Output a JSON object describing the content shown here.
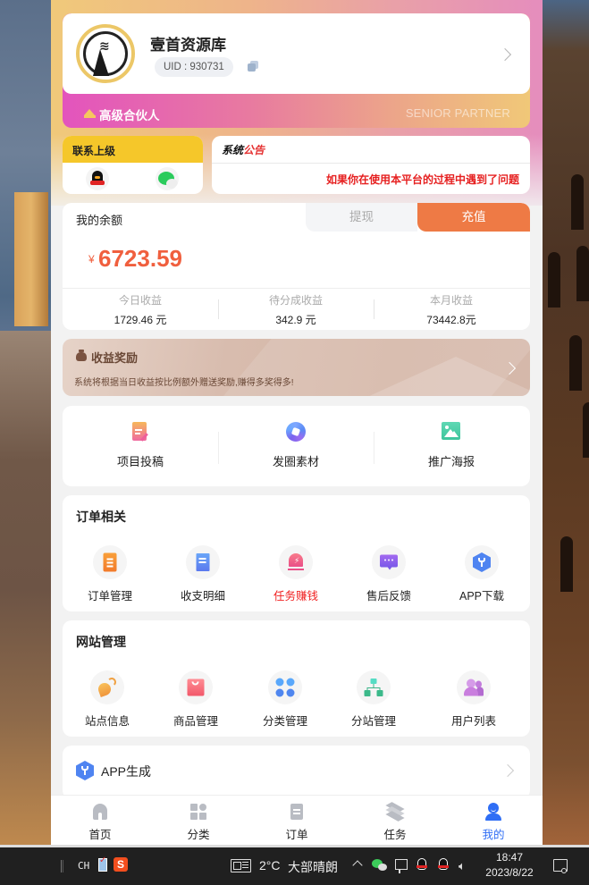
{
  "profile": {
    "name": "壹首资源库",
    "uid": "UID : 930731",
    "level": "高级合伙人",
    "level_en": "SENIOR PARTNER"
  },
  "contact": {
    "title": "联系上级",
    "icons": [
      "qq-icon",
      "wechat-icon"
    ]
  },
  "notice": {
    "title_part1": "系统",
    "title_part2": "公告",
    "message": "如果你在使用本平台的过程中遇到了问题"
  },
  "balance": {
    "title": "我的余额",
    "withdraw_label": "提现",
    "recharge_label": "充值",
    "currency": "¥",
    "amount": "6723.59",
    "stats": [
      {
        "label": "今日收益",
        "value": "1729.46 元"
      },
      {
        "label": "待分成收益",
        "value": "342.9 元"
      },
      {
        "label": "本月收益",
        "value": "73442.8元"
      }
    ]
  },
  "reward": {
    "title": "收益奖励",
    "description": "系统将根据当日收益按比例额外赠送奖励,赚得多奖得多!"
  },
  "quick_actions": [
    {
      "label": "项目投稿",
      "icon": "document-edit-icon"
    },
    {
      "label": "发圈素材",
      "icon": "aperture-icon"
    },
    {
      "label": "推广海报",
      "icon": "image-icon"
    }
  ],
  "order_section": {
    "title": "订单相关",
    "items": [
      {
        "label": "订单管理",
        "icon": "clipboard-icon"
      },
      {
        "label": "收支明细",
        "icon": "receipt-icon"
      },
      {
        "label": "任务赚钱",
        "icon": "alarm-icon",
        "highlight": true
      },
      {
        "label": "售后反馈",
        "icon": "chat-bubble-icon"
      },
      {
        "label": "APP下载",
        "icon": "cube-icon"
      }
    ]
  },
  "site_section": {
    "title": "网站管理",
    "items": [
      {
        "label": "站点信息",
        "icon": "satellite-dish-icon"
      },
      {
        "label": "商品管理",
        "icon": "shopping-bag-icon"
      },
      {
        "label": "分类管理",
        "icon": "grid-dots-icon"
      },
      {
        "label": "分站管理",
        "icon": "org-tree-icon"
      },
      {
        "label": "用户列表",
        "icon": "users-icon"
      }
    ]
  },
  "app_gen": {
    "label": "APP生成"
  },
  "tabbar": {
    "active_color": "#2f6ef5",
    "items": [
      {
        "label": "首页",
        "icon": "home-icon"
      },
      {
        "label": "分类",
        "icon": "category-icon"
      },
      {
        "label": "订单",
        "icon": "order-icon"
      },
      {
        "label": "任务",
        "icon": "layers-icon"
      },
      {
        "label": "我的",
        "icon": "user-icon",
        "active": true
      }
    ]
  },
  "taskbar": {
    "ime": "CH",
    "temperature": "2°C",
    "weather": "大部晴朗",
    "time": "18:47",
    "date": "2023/8/22"
  },
  "colors": {
    "accent_orange": "#ee7a45",
    "amount_red": "#f05f3e",
    "notice_red": "#e62020",
    "contact_yellow": "#f5c72a",
    "active_blue": "#2f6ef5"
  }
}
